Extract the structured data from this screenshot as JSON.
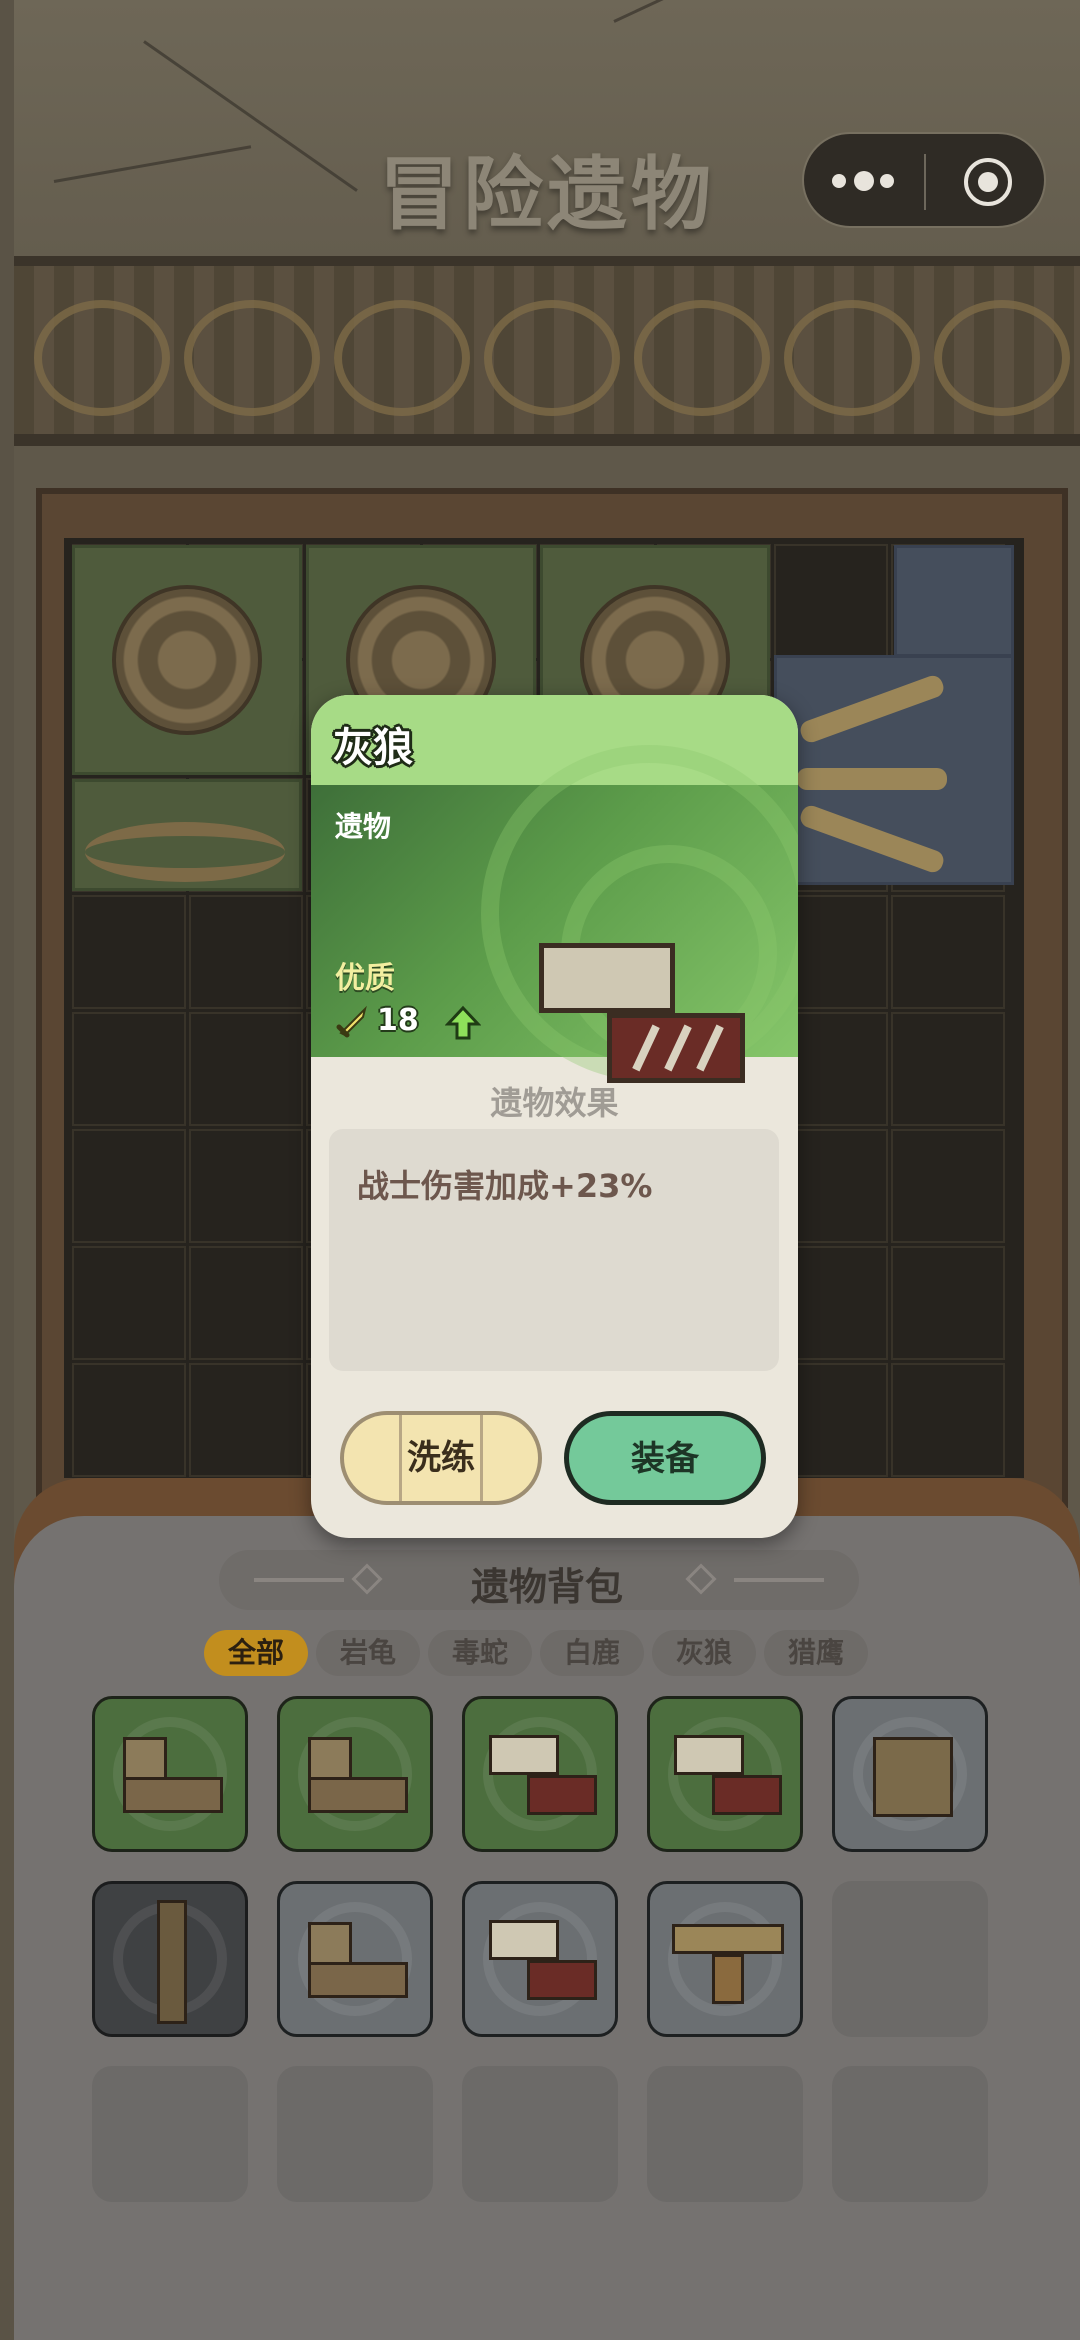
{
  "header": {
    "title": "冒险遗物"
  },
  "popup": {
    "name": "灰狼",
    "type_label": "遗物",
    "quality": "优质",
    "power": "18",
    "effect_title": "遗物效果",
    "effect_text": "战士伤害加成+23%",
    "reroll_label": "洗练",
    "equip_label": "装备"
  },
  "bag": {
    "title": "遗物背包",
    "tabs": [
      "全部",
      "岩龟",
      "毒蛇",
      "白鹿",
      "灰狼",
      "猎鹰"
    ],
    "active_tab": "全部",
    "slots": [
      {
        "relic": "白鹿",
        "rarity": "green"
      },
      {
        "relic": "白鹿",
        "rarity": "green"
      },
      {
        "relic": "灰狼",
        "rarity": "green"
      },
      {
        "relic": "灰狼",
        "rarity": "green"
      },
      {
        "relic": "岩龟",
        "rarity": "gray"
      },
      {
        "relic": "毒蛇",
        "rarity": "dark"
      },
      {
        "relic": "白鹿",
        "rarity": "gray"
      },
      {
        "relic": "灰狼",
        "rarity": "gray"
      },
      {
        "relic": "猎鹰",
        "rarity": "gray"
      },
      {
        "relic": "",
        "rarity": "empty"
      },
      {
        "relic": "",
        "rarity": "empty"
      },
      {
        "relic": "",
        "rarity": "empty"
      },
      {
        "relic": "",
        "rarity": "empty"
      },
      {
        "relic": "",
        "rarity": "empty"
      },
      {
        "relic": "",
        "rarity": "empty"
      }
    ]
  },
  "colors": {
    "accent_tab": "#c28e1e",
    "equip_button": "#74c99a",
    "reroll_button": "#f3e4b0",
    "popup_header": "#a7db86"
  },
  "icons": [
    "more-dots-icon",
    "target-icon",
    "sword-icon",
    "arrow-up-icon"
  ]
}
